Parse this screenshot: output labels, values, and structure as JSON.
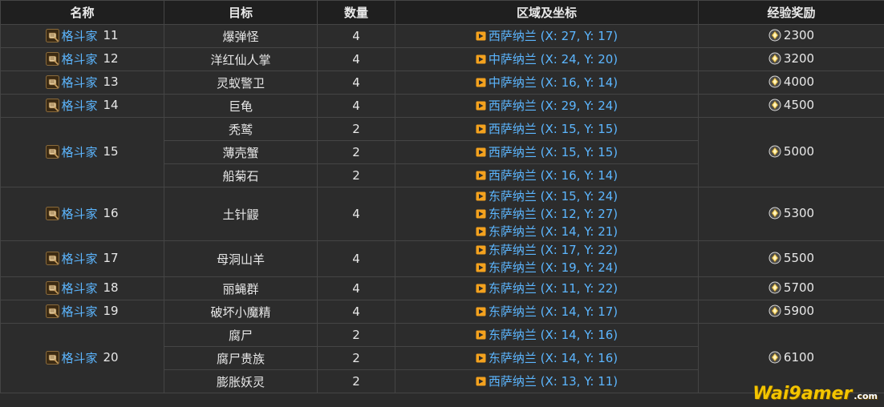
{
  "headers": {
    "name": "名称",
    "target": "目标",
    "count": "数量",
    "location": "区域及坐标",
    "exp": "经验奖励"
  },
  "rows": [
    {
      "name": {
        "label": "格斗家",
        "num": "11"
      },
      "exp": "2300",
      "targets": [
        {
          "target": "爆弹怪",
          "count": "4",
          "locs": [
            {
              "zone": "西萨纳兰",
              "coord": "(X: 27, Y: 17)"
            }
          ]
        }
      ]
    },
    {
      "name": {
        "label": "格斗家",
        "num": "12"
      },
      "exp": "3200",
      "targets": [
        {
          "target": "洋红仙人掌",
          "count": "4",
          "locs": [
            {
              "zone": "中萨纳兰",
              "coord": "(X: 24, Y: 20)"
            }
          ]
        }
      ]
    },
    {
      "name": {
        "label": "格斗家",
        "num": "13"
      },
      "exp": "4000",
      "targets": [
        {
          "target": "灵蚁警卫",
          "count": "4",
          "locs": [
            {
              "zone": "中萨纳兰",
              "coord": "(X: 16, Y: 14)"
            }
          ]
        }
      ]
    },
    {
      "name": {
        "label": "格斗家",
        "num": "14"
      },
      "exp": "4500",
      "targets": [
        {
          "target": "巨龟",
          "count": "4",
          "locs": [
            {
              "zone": "西萨纳兰",
              "coord": "(X: 29, Y: 24)"
            }
          ]
        }
      ]
    },
    {
      "name": {
        "label": "格斗家",
        "num": "15"
      },
      "exp": "5000",
      "targets": [
        {
          "target": "秃鹫",
          "count": "2",
          "locs": [
            {
              "zone": "西萨纳兰",
              "coord": "(X: 15, Y: 15)"
            }
          ]
        },
        {
          "target": "薄壳蟹",
          "count": "2",
          "locs": [
            {
              "zone": "西萨纳兰",
              "coord": "(X: 15, Y: 15)"
            }
          ]
        },
        {
          "target": "船菊石",
          "count": "2",
          "locs": [
            {
              "zone": "西萨纳兰",
              "coord": "(X: 16, Y: 14)"
            }
          ]
        }
      ]
    },
    {
      "name": {
        "label": "格斗家",
        "num": "16"
      },
      "exp": "5300",
      "targets": [
        {
          "target": "土针鼹",
          "count": "4",
          "locs": [
            {
              "zone": "东萨纳兰",
              "coord": "(X: 15, Y: 24)"
            },
            {
              "zone": "东萨纳兰",
              "coord": "(X: 12, Y: 27)"
            },
            {
              "zone": "东萨纳兰",
              "coord": "(X: 14, Y: 21)"
            }
          ]
        }
      ]
    },
    {
      "name": {
        "label": "格斗家",
        "num": "17"
      },
      "exp": "5500",
      "targets": [
        {
          "target": "母洞山羊",
          "count": "4",
          "locs": [
            {
              "zone": "东萨纳兰",
              "coord": "(X: 17, Y: 22)"
            },
            {
              "zone": "东萨纳兰",
              "coord": "(X: 19, Y: 24)"
            }
          ]
        }
      ]
    },
    {
      "name": {
        "label": "格斗家",
        "num": "18"
      },
      "exp": "5700",
      "targets": [
        {
          "target": "丽蝇群",
          "count": "4",
          "locs": [
            {
              "zone": "东萨纳兰",
              "coord": "(X: 11, Y: 22)"
            }
          ]
        }
      ]
    },
    {
      "name": {
        "label": "格斗家",
        "num": "19"
      },
      "exp": "5900",
      "targets": [
        {
          "target": "破坏小魔精",
          "count": "4",
          "locs": [
            {
              "zone": "东萨纳兰",
              "coord": "(X: 14, Y: 17)"
            }
          ]
        }
      ]
    },
    {
      "name": {
        "label": "格斗家",
        "num": "20"
      },
      "exp": "6100",
      "targets": [
        {
          "target": "腐尸",
          "count": "2",
          "locs": [
            {
              "zone": "东萨纳兰",
              "coord": "(X: 14, Y: 16)"
            }
          ]
        },
        {
          "target": "腐尸贵族",
          "count": "2",
          "locs": [
            {
              "zone": "东萨纳兰",
              "coord": "(X: 14, Y: 16)"
            }
          ]
        },
        {
          "target": "膨胀妖灵",
          "count": "2",
          "locs": [
            {
              "zone": "西萨纳兰",
              "coord": "(X: 13, Y: 11)"
            }
          ]
        }
      ]
    }
  ],
  "icons": {
    "name": "scroll-icon",
    "location": "map-flag-icon",
    "exp": "exp-crystal-icon"
  },
  "colors": {
    "link": "#5cb6ff",
    "flag": "#f4a21e",
    "header_bg": "#1f1f1f",
    "cell_bg": "#2c2c2c",
    "border": "#454545"
  },
  "watermark": {
    "brand": "Wai9amer",
    "suffix": ".com"
  }
}
